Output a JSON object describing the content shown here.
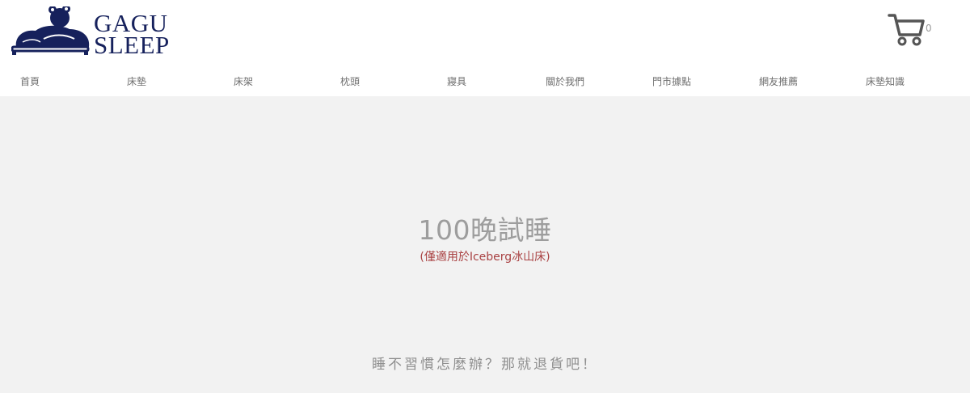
{
  "brand": {
    "name_line1": "GAGU",
    "name_line2": "SLEEP",
    "logo_color": "#16215c"
  },
  "cart": {
    "icon": "shopping-cart-icon",
    "count": "0"
  },
  "nav": {
    "items": [
      {
        "label": "首頁"
      },
      {
        "label": "床墊"
      },
      {
        "label": "床架"
      },
      {
        "label": "枕頭"
      },
      {
        "label": "寢具"
      },
      {
        "label": "關於我們"
      },
      {
        "label": "門市據點"
      },
      {
        "label": "網友推薦"
      },
      {
        "label": "床墊知識"
      }
    ]
  },
  "hero": {
    "title": "100晚試睡",
    "subtitle": "(僅適用於Iceberg冰山床)",
    "tagline": "睡不習慣怎麼辦？那就退貨吧！",
    "background": "#f2f2f2",
    "subtitle_color": "#a94142"
  }
}
